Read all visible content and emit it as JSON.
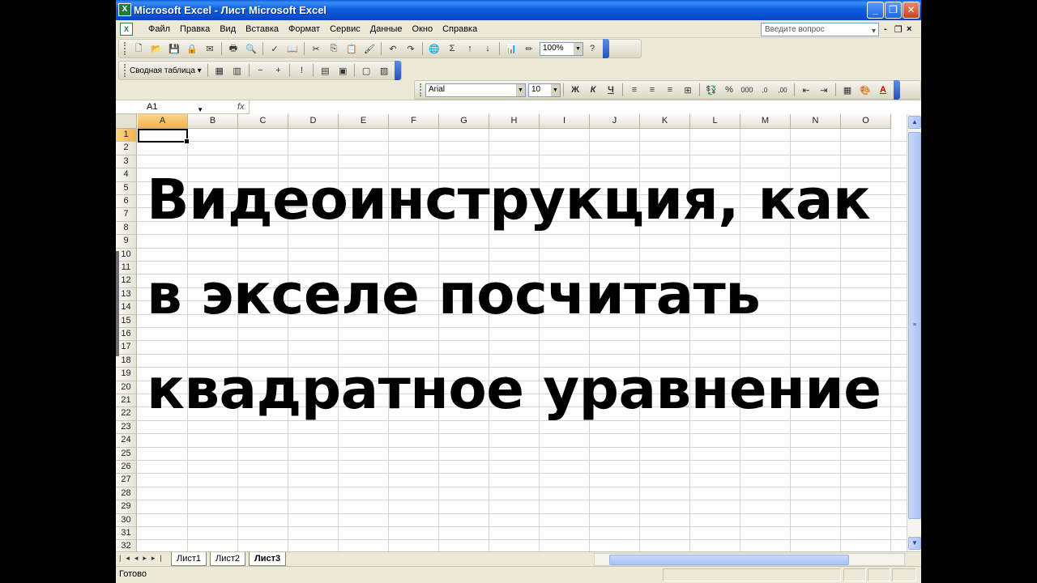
{
  "window": {
    "title": "Microsoft Excel - Лист Microsoft Excel",
    "app_icon": "excel-icon",
    "controls": [
      "_",
      "❐",
      "✕"
    ]
  },
  "menu": {
    "items": [
      "Файл",
      "Правка",
      "Вид",
      "Вставка",
      "Формат",
      "Сервис",
      "Данные",
      "Окно",
      "Справка"
    ],
    "help_placeholder": "Введите вопрос",
    "doc_controls": [
      "-",
      "❐",
      "×"
    ]
  },
  "toolbar_standard": {
    "zoom": "100%"
  },
  "toolbar_pivot": {
    "label": "Сводная таблица ▾"
  },
  "toolbar_format": {
    "font": "Arial",
    "size": "10",
    "bold": "Ж",
    "italic": "К",
    "underline": "Ч",
    "percent": "%",
    "thousands": "000",
    "font_color_label": "A"
  },
  "formula_bar": {
    "name_box": "A1",
    "fx": "fx",
    "value": ""
  },
  "grid": {
    "columns": [
      "A",
      "B",
      "C",
      "D",
      "E",
      "F",
      "G",
      "H",
      "I",
      "J",
      "K",
      "L",
      "M",
      "N",
      "O"
    ],
    "rows": [
      "1",
      "2",
      "3",
      "4",
      "5",
      "6",
      "7",
      "8",
      "9",
      "10",
      "11",
      "12",
      "13",
      "14",
      "15",
      "16",
      "17",
      "18",
      "19",
      "20",
      "21",
      "22",
      "23",
      "24",
      "25",
      "26",
      "27",
      "28",
      "29",
      "30",
      "31",
      "32"
    ],
    "selected_cell": "A1"
  },
  "overlay_text": {
    "line1": "Видеоинструкция, как",
    "line2": "в экселе посчитать",
    "line3": "квадратное уравнение"
  },
  "sheet_tabs": [
    "Лист1",
    "Лист2",
    "Лист3"
  ],
  "active_sheet": "Лист3",
  "status": {
    "ready": "Готово"
  }
}
